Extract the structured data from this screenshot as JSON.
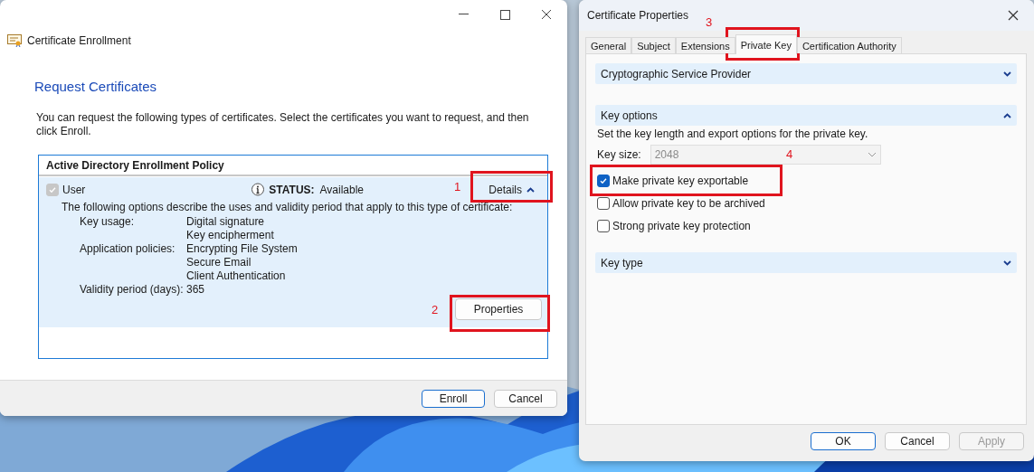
{
  "enrollment_window": {
    "title": "Certificate Enrollment",
    "heading": "Request Certificates",
    "intro": "You can request the following types of certificates. Select the certificates you want to request, and then click Enroll.",
    "policy": {
      "title": "Active Directory Enrollment Policy",
      "item": {
        "name": "User",
        "checked": true,
        "disabled": true,
        "status_label": "STATUS:",
        "status": "Available",
        "details": "Details",
        "expanded": true,
        "description": "The following options describe the uses and validity period that apply to this type of certificate:",
        "fields": [
          {
            "label": "Key usage:",
            "values": [
              "Digital signature",
              "Key encipherment"
            ]
          },
          {
            "label": "Application policies:",
            "values": [
              "Encrypting File System",
              "Secure Email",
              "Client Authentication"
            ]
          },
          {
            "label": "Validity period (days):",
            "values": [
              "365"
            ]
          }
        ],
        "properties_button": "Properties"
      }
    },
    "buttons": [
      {
        "label": "Enroll",
        "default": true
      },
      {
        "label": "Cancel",
        "default": false
      }
    ]
  },
  "properties_window": {
    "title": "Certificate Properties",
    "tabs": [
      {
        "label": "General",
        "selected": false
      },
      {
        "label": "Subject",
        "selected": false
      },
      {
        "label": "Extensions",
        "selected": false
      },
      {
        "label": "Private Key",
        "selected": true
      },
      {
        "label": "Certification Authority",
        "selected": false
      }
    ],
    "sections": [
      {
        "title": "Cryptographic Service Provider",
        "expanded": false
      },
      {
        "title": "Key options",
        "expanded": true,
        "description": "Set the key length and export options for the private key.",
        "key_size_label": "Key size:",
        "key_size": "2048",
        "key_size_disabled": true,
        "options": [
          {
            "label": "Make private key exportable",
            "checked": true
          },
          {
            "label": "Allow private key to be archived",
            "checked": false
          },
          {
            "label": "Strong private key protection",
            "checked": false
          }
        ]
      },
      {
        "title": "Key type",
        "expanded": false
      }
    ],
    "buttons": [
      {
        "label": "OK",
        "default": true,
        "disabled": false
      },
      {
        "label": "Cancel",
        "default": false,
        "disabled": false
      },
      {
        "label": "Apply",
        "default": false,
        "disabled": true
      }
    ]
  },
  "annotations": [
    {
      "number": "1"
    },
    {
      "number": "2"
    },
    {
      "number": "3"
    },
    {
      "number": "4"
    }
  ]
}
